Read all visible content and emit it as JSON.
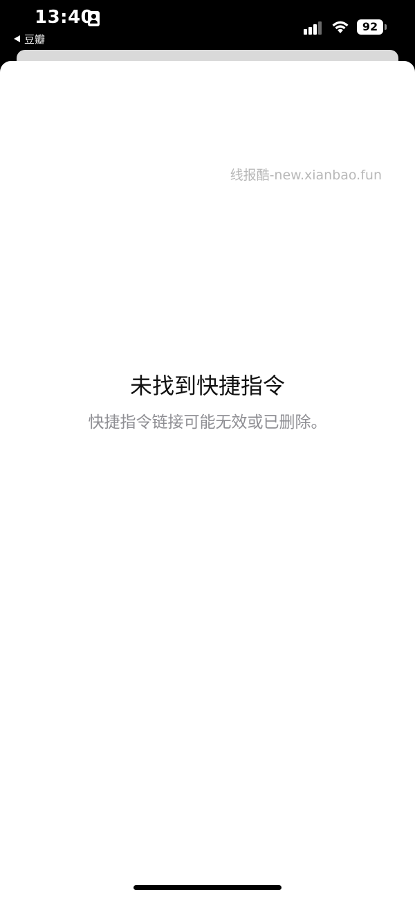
{
  "status_bar": {
    "time": "13:40",
    "back_app": "豆瓣",
    "battery_level": "92",
    "signal_icon": "cellular-signal-icon",
    "wifi_icon": "wifi-icon",
    "contact_icon": "contact-card-icon"
  },
  "watermark": {
    "text": "线报酷-new.xianbao.fun"
  },
  "error": {
    "title": "未找到快捷指令",
    "message": "快捷指令链接可能无效或已删除。"
  },
  "colors": {
    "status_bar_bg": "#000000",
    "sheet_bg": "#ffffff",
    "title_text": "#111111",
    "message_text": "#8e8e93",
    "watermark_text": "#b8b8b8"
  }
}
